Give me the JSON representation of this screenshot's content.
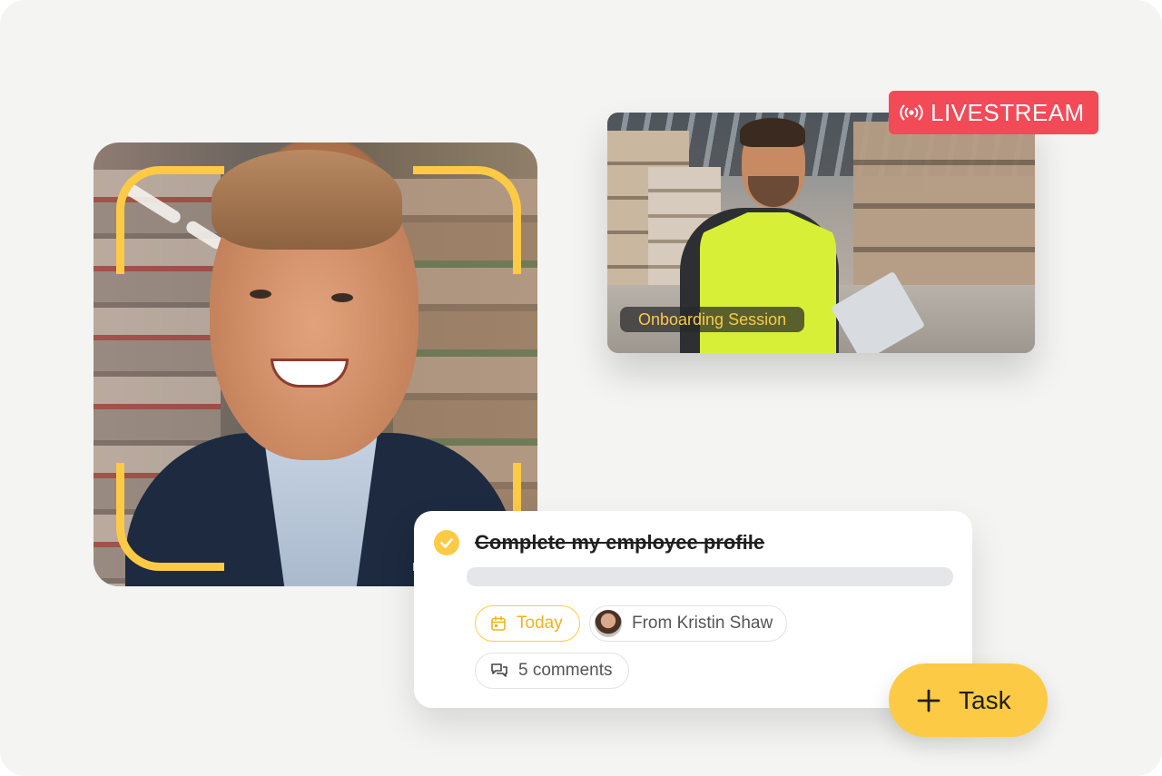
{
  "profile_photo": {
    "icon": "face-scan-frame",
    "accent_color": "#fcca45"
  },
  "video": {
    "caption": "Onboarding Session",
    "live_badge": {
      "label": "LIVESTREAM",
      "icon": "broadcast-icon",
      "color": "#f24a57"
    }
  },
  "task": {
    "title": "Complete my employee profile",
    "completed": true,
    "due_chip": {
      "label": "Today",
      "icon": "calendar-icon"
    },
    "from_chip": {
      "label": "From Kristin Shaw"
    },
    "comments_chip": {
      "label": "5 comments",
      "icon": "comments-icon"
    }
  },
  "add_task_button": {
    "label": "Task",
    "icon": "plus-icon"
  },
  "colors": {
    "accent": "#fcca45",
    "live": "#f24a57",
    "background": "#f4f4f2"
  }
}
